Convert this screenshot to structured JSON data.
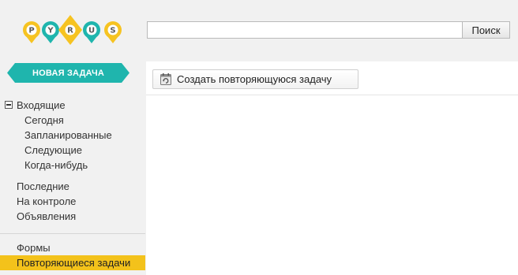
{
  "logo": {
    "letters": [
      "P",
      "Y",
      "R",
      "U",
      "S"
    ]
  },
  "search": {
    "value": "",
    "placeholder": "",
    "button_label": "Поиск"
  },
  "new_task": {
    "label": "НОВАЯ ЗАДАЧА"
  },
  "sidebar": {
    "inbox": {
      "label": "Входящие",
      "expanded": true
    },
    "inbox_children": [
      "Сегодня",
      "Запланированные",
      "Следующие",
      "Когда-нибудь"
    ],
    "group2": [
      "Последние",
      "На контроле",
      "Объявления"
    ],
    "group3": [
      "Формы",
      "Повторяющиеся задачи"
    ],
    "active_item": "Повторяющиеся задачи"
  },
  "toolbar": {
    "create_recurring_label": "Создать повторяющуюся задачу",
    "icon": "calendar-repeat-icon"
  },
  "colors": {
    "accent": "#1fb5ad",
    "active": "#f3c21b",
    "logo_yellow": "#f6c321"
  }
}
